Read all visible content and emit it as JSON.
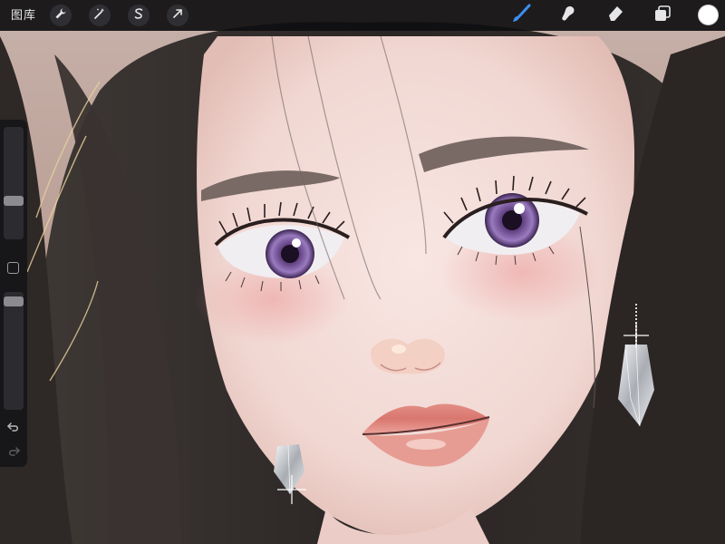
{
  "app": {
    "theme_bar_color": "#0e0e10"
  },
  "toolbar": {
    "gallery_label": "图库",
    "actions": [
      {
        "name": "actions-wrench-icon"
      },
      {
        "name": "adjustments-magic-wand-icon"
      },
      {
        "name": "selection-s-icon"
      },
      {
        "name": "transform-arrow-icon"
      }
    ],
    "paint_tools": [
      {
        "name": "brush-icon",
        "active": true
      },
      {
        "name": "smudge-icon",
        "active": false
      },
      {
        "name": "eraser-icon",
        "active": false
      },
      {
        "name": "layers-icon",
        "active": false
      }
    ],
    "accent_color": "#3d8ef2",
    "current_color": "#ffffff"
  },
  "sidebar": {
    "brush_size_level": 0.5,
    "opacity_level": 0.03
  }
}
